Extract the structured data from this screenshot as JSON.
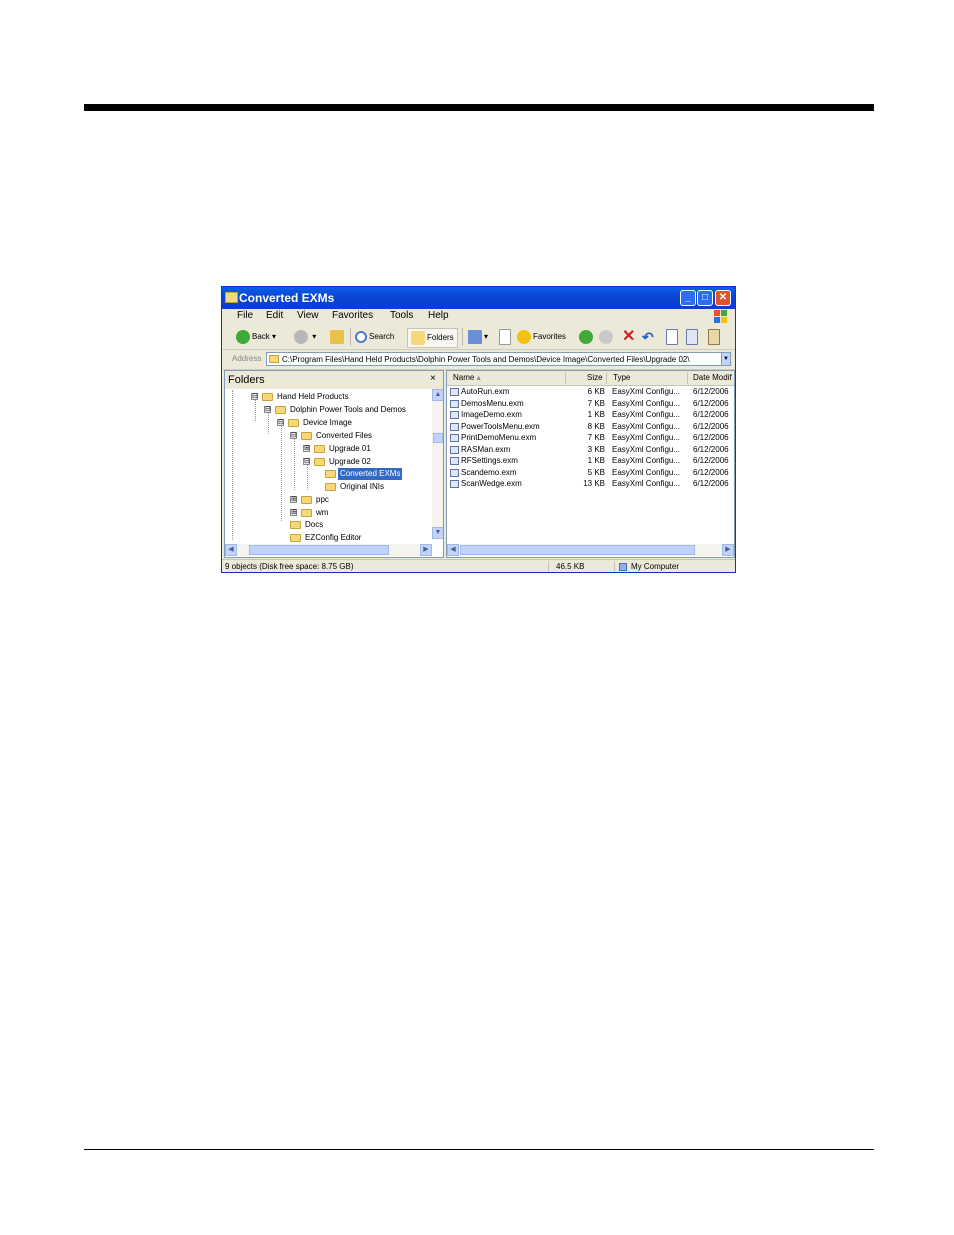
{
  "window": {
    "title": "Converted EXMs",
    "minimize": "_",
    "maximize": "□",
    "close": "✕"
  },
  "menu": [
    "File",
    "Edit",
    "View",
    "Favorites",
    "Tools",
    "Help"
  ],
  "toolbar": {
    "back": "Back",
    "search": "Search",
    "folders": "Folders",
    "favorites": "Favorites"
  },
  "address": {
    "label": "Address",
    "path": "C:\\Program Files\\Hand Held Products\\Dolphin Power Tools and Demos\\Device Image\\Converted Files\\Upgrade 02\\"
  },
  "folders_pane": {
    "title": "Folders",
    "close": "×",
    "tree": [
      {
        "label": "Hand Held Products",
        "toggle": "⊟"
      },
      {
        "label": "Dolphin Power Tools and Demos",
        "toggle": "⊟"
      },
      {
        "label": "Device Image",
        "toggle": "⊟"
      },
      {
        "label": "Converted Files",
        "toggle": "⊟"
      },
      {
        "label": "Upgrade 01",
        "toggle": "⊞"
      },
      {
        "label": "Upgrade 02",
        "toggle": "⊟"
      },
      {
        "label": "Converted EXMs",
        "toggle": "",
        "selected": true
      },
      {
        "label": "Original INIs",
        "toggle": ""
      },
      {
        "label": "ppc",
        "toggle": "⊞"
      },
      {
        "label": "wm",
        "toggle": "⊞"
      },
      {
        "label": "Docs",
        "toggle": ""
      },
      {
        "label": "EZConfig Editor",
        "toggle": ""
      }
    ]
  },
  "file_list": {
    "columns": [
      "Name",
      "Size",
      "Type",
      "Date Modif"
    ],
    "rows": [
      {
        "name": "AutoRun.exm",
        "size": "6 KB",
        "type": "EasyXml Configu...",
        "date": "6/12/2006"
      },
      {
        "name": "DemosMenu.exm",
        "size": "7 KB",
        "type": "EasyXml Configu...",
        "date": "6/12/2006"
      },
      {
        "name": "ImageDemo.exm",
        "size": "1 KB",
        "type": "EasyXml Configu...",
        "date": "6/12/2006"
      },
      {
        "name": "PowerToolsMenu.exm",
        "size": "8 KB",
        "type": "EasyXml Configu...",
        "date": "6/12/2006"
      },
      {
        "name": "PrintDemoMenu.exm",
        "size": "7 KB",
        "type": "EasyXml Configu...",
        "date": "6/12/2006"
      },
      {
        "name": "RASMan.exm",
        "size": "3 KB",
        "type": "EasyXml Configu...",
        "date": "6/12/2006"
      },
      {
        "name": "RFSettings.exm",
        "size": "1 KB",
        "type": "EasyXml Configu...",
        "date": "6/12/2006"
      },
      {
        "name": "Scandemo.exm",
        "size": "5 KB",
        "type": "EasyXml Configu...",
        "date": "6/12/2006"
      },
      {
        "name": "ScanWedge.exm",
        "size": "13 KB",
        "type": "EasyXml Configu...",
        "date": "6/12/2006"
      }
    ]
  },
  "status": {
    "objects": "9 objects (Disk free space: 8.75 GB)",
    "size": "46.5 KB",
    "location": "My Computer"
  }
}
